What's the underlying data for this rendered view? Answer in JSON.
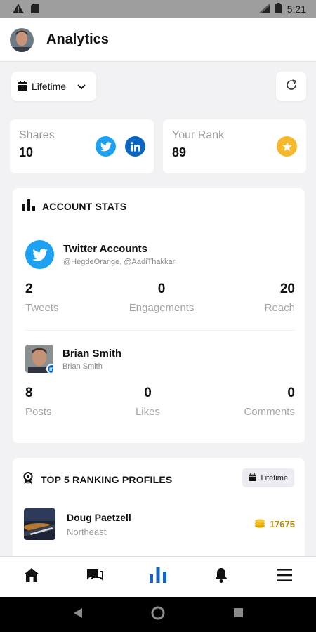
{
  "status_bar": {
    "time": "5:21"
  },
  "header": {
    "title": "Analytics"
  },
  "filter": {
    "period_label": "Lifetime"
  },
  "summary": {
    "shares": {
      "label": "Shares",
      "value": "10"
    },
    "rank": {
      "label": "Your Rank",
      "value": "89"
    }
  },
  "account_stats": {
    "heading": "ACCOUNT STATS",
    "twitter": {
      "name": "Twitter Accounts",
      "handles": "@HegdeOrange, @AadiThakkar",
      "metrics": [
        {
          "value": "2",
          "label": "Tweets"
        },
        {
          "value": "0",
          "label": "Engagements"
        },
        {
          "value": "20",
          "label": "Reach"
        }
      ]
    },
    "linkedin": {
      "name": "Brian Smith",
      "sub": "Brian Smith",
      "metrics": [
        {
          "value": "8",
          "label": "Posts"
        },
        {
          "value": "0",
          "label": "Likes"
        },
        {
          "value": "0",
          "label": "Comments"
        }
      ]
    }
  },
  "top_profiles": {
    "heading": "TOP 5 RANKING PROFILES",
    "filter_label": "Lifetime",
    "items": [
      {
        "name": "Doug Paetzell",
        "region": "Northeast",
        "points": "17675"
      }
    ]
  },
  "colors": {
    "twitter": "#1da1f2",
    "linkedin": "#0a66c2",
    "star": "#f5b82e",
    "active_nav": "#1565c0",
    "points": "#b08a10"
  },
  "icons": {
    "nav": [
      "home-icon",
      "chat-icon",
      "analytics-icon",
      "bell-icon",
      "menu-icon"
    ]
  }
}
